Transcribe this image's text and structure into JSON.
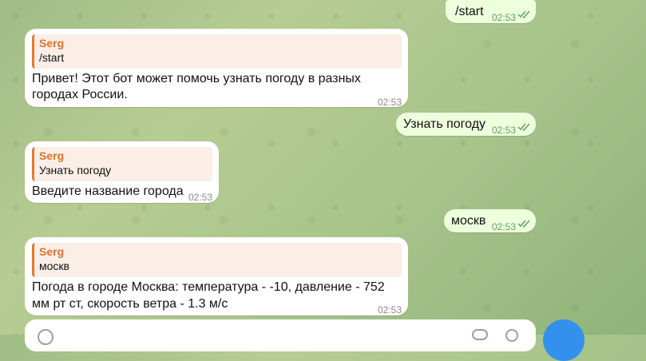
{
  "messages": [
    {
      "type": "outgoing",
      "text": "/start",
      "time": "02:53"
    },
    {
      "type": "incoming",
      "reply_name": "Serg",
      "reply_text": "/start",
      "line1": "Привет! Этот бот может помочь узнать погоду в разных",
      "line2": "городах России.",
      "time": "02:53"
    },
    {
      "type": "outgoing",
      "text": "Узнать погоду",
      "time": "02:53"
    },
    {
      "type": "incoming",
      "reply_name": "Serg",
      "reply_text": "Узнать погоду",
      "line1": "Введите название города",
      "time": "02:53"
    },
    {
      "type": "outgoing",
      "text": "москв",
      "time": "02:53"
    },
    {
      "type": "incoming",
      "reply_name": "Serg",
      "reply_text": "москв",
      "line1": "Погода в городе Москва: температура - -10, давление - 752",
      "line2": "мм рт ст, скорость ветра - 1.3 м/с",
      "time": "02:53"
    }
  ],
  "icons": {
    "read_status": "double-check-icon",
    "emoji": "emoji-icon",
    "attach": "attach-icon",
    "send": "send-icon"
  },
  "colors": {
    "outgoing_bubble": "#eeffde",
    "incoming_bubble": "#ffffff",
    "reply_accent": "#e07a35",
    "send_button": "#3390ec"
  }
}
